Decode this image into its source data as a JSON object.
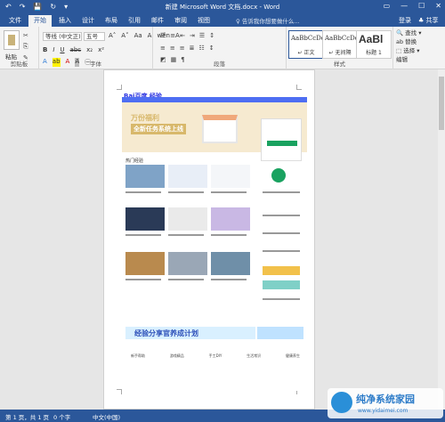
{
  "window": {
    "title": "新建 Microsoft Word 文档.docx - Word",
    "quick_access": [
      "↶",
      "↷",
      "💾",
      "↻",
      "▾"
    ],
    "controls": [
      "▭",
      "—",
      "☐",
      "✕"
    ]
  },
  "tabs": [
    "文件",
    "开始",
    "插入",
    "设计",
    "布局",
    "引用",
    "邮件",
    "审阅",
    "视图"
  ],
  "active_tab": "开始",
  "tellme": "♀ 告诉我你想要做什么...",
  "login": "登录",
  "share": "♣ 共享",
  "ribbon": {
    "clipboard": {
      "paste": "粘贴",
      "label": "剪贴板"
    },
    "font": {
      "family": "等线 (中文正)",
      "size": "五号",
      "grow": "A˄",
      "shrink": "A˅",
      "case": "Aa",
      "clear": "A",
      "wen": "wén",
      "A_box": "A",
      "bold": "B",
      "italic": "I",
      "underline": "U",
      "strike": "abc",
      "sub": "x₂",
      "sup": "x²",
      "effects": "A",
      "highlight": "ab",
      "color": "A",
      "shade": "A",
      "circled": "㊀",
      "label": "字体"
    },
    "paragraph": {
      "row1": [
        "☰",
        "≡",
        "⇤",
        "⇥",
        "☰",
        "↕"
      ],
      "row2": [
        "≡",
        "≡",
        "≡",
        "≣",
        "☷",
        "↕"
      ],
      "row3": [
        "◩",
        "▦",
        "¶"
      ],
      "label": "段落"
    },
    "styles": {
      "items": [
        {
          "sample": "AaBbCcDd",
          "name": "↵ 正文"
        },
        {
          "sample": "AaBbCcDd",
          "name": "↵ 无间隔"
        },
        {
          "sample": "AaBl",
          "name": "标题 1"
        }
      ],
      "label": "样式"
    },
    "editing": {
      "find": "🔍 查找 ▾",
      "replace": "ab 替换",
      "select": "⬚ 选择 ▾",
      "label": "编辑"
    }
  },
  "page_picture": {
    "logo": "Bai百度 经验",
    "banner_title": "万份福利",
    "banner_sub": "全新任务系统上线",
    "section": "热门经验",
    "ad_text": "经验分享官养成计划",
    "footer_cols": [
      "新手帮助",
      "游戏精品",
      "手工DIY",
      "生活常识",
      "健康养生"
    ]
  },
  "statusbar": {
    "page": "第 1 页，共 1 页",
    "words": "0 个字",
    "lang": "中文(中国)"
  },
  "watermark": {
    "text": "纯净系统家园",
    "url": "www.yidaimei.com"
  }
}
